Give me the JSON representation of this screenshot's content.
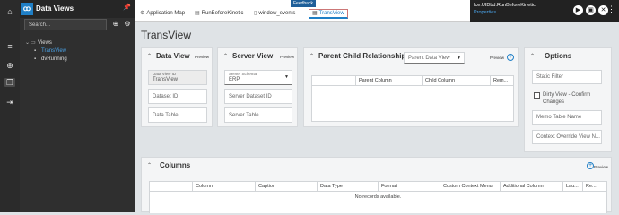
{
  "rail": {
    "icons": [
      "home-icon",
      "list-icon",
      "layers-icon",
      "copy-icon",
      "exit-icon"
    ]
  },
  "side": {
    "title": "Data Views",
    "search_placeholder": "Search...",
    "tree": {
      "root": "Views",
      "children": [
        "TransView",
        "dvRunning"
      ]
    }
  },
  "topbar": {
    "feedback": "Feedback",
    "tabs": [
      {
        "label": "Application Map",
        "icon": "gear-icon"
      },
      {
        "label": "RunBeforeKinetic",
        "icon": "document-icon"
      },
      {
        "label": "window_events",
        "icon": "window-icon"
      },
      {
        "label": "TransView",
        "icon": "grid-icon"
      }
    ],
    "right_title": "Ice.UIDbd.RunBeforeKinetic",
    "right_sub": "Properties"
  },
  "main": {
    "page_title": "TransView",
    "data_view": {
      "title": "Data View",
      "preview": "Preview",
      "data_view_id_label": "Data View ID",
      "data_view_id_value": "TransView",
      "dataset_id": "Dataset ID",
      "data_table": "Data Table"
    },
    "server_view": {
      "title": "Server View",
      "preview": "Preview",
      "schema_label": "Server Schema",
      "schema_value": "ERP",
      "server_dataset_id": "Server Dataset ID",
      "server_table": "Server Table"
    },
    "parent_child": {
      "title": "Parent Child Relationships",
      "select_value": "Parent Data View",
      "preview": "Preview",
      "columns": [
        "Parent Column",
        "Child Column",
        "Rem..."
      ]
    },
    "options": {
      "title": "Options",
      "static_filter": "Static Filter",
      "dirty_view": "Dirty View - Confirm Changes",
      "memo_table": "Memo Table Name",
      "context_override": "Context Override View N..."
    },
    "columns": {
      "title": "Columns",
      "preview": "Preview",
      "headers": [
        "Column",
        "Caption",
        "Data Type",
        "Format",
        "Custom Context Menu",
        "Additional Column",
        "Lau...",
        "Re..."
      ],
      "empty": "No records available."
    }
  }
}
